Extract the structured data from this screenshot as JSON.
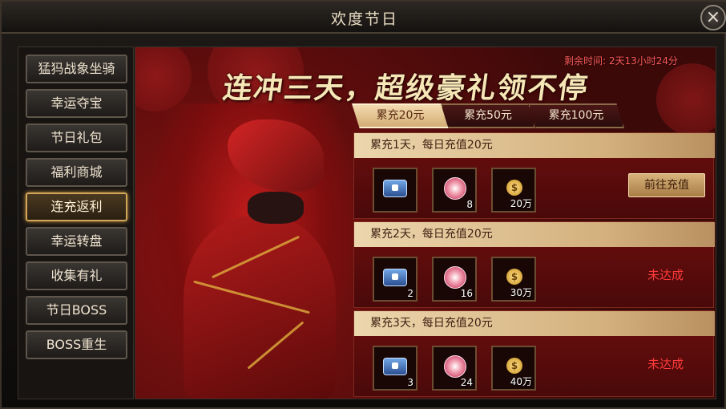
{
  "window": {
    "title": "欢度节日",
    "close_icon": "close-icon"
  },
  "sidebar": {
    "items": [
      {
        "label": "猛犸战象坐骑"
      },
      {
        "label": "幸运夺宝"
      },
      {
        "label": "节日礼包"
      },
      {
        "label": "福利商城"
      },
      {
        "label": "连充返利",
        "active": true
      },
      {
        "label": "幸运转盘"
      },
      {
        "label": "收集有礼"
      },
      {
        "label": "节日BOSS"
      },
      {
        "label": "BOSS重生"
      }
    ]
  },
  "banner": {
    "slogan": "连冲三天，超级豪礼领不停",
    "timer": "剩余时间: 2天13小时24分"
  },
  "tabs": [
    {
      "label": "累充20元",
      "active": true
    },
    {
      "label": "累充50元"
    },
    {
      "label": "累充100元"
    }
  ],
  "rows": [
    {
      "title": "累充1天，每日充值20元",
      "items": [
        {
          "icon": "ticket-icon",
          "qty": ""
        },
        {
          "icon": "flower-icon",
          "qty": "8"
        },
        {
          "icon": "coin-icon",
          "qty": "20万"
        }
      ],
      "action": "前往充值"
    },
    {
      "title": "累充2天，每日充值20元",
      "items": [
        {
          "icon": "ticket-icon",
          "qty": "2"
        },
        {
          "icon": "flower-icon",
          "qty": "16"
        },
        {
          "icon": "coin-icon",
          "qty": "30万"
        }
      ],
      "status": "未达成"
    },
    {
      "title": "累充3天，每日充值20元",
      "items": [
        {
          "icon": "ticket-icon",
          "qty": "3"
        },
        {
          "icon": "flower-icon",
          "qty": "24"
        },
        {
          "icon": "coin-icon",
          "qty": "40万"
        }
      ],
      "status": "未达成"
    }
  ],
  "colors": {
    "accent": "#d3a65a",
    "status_red": "#ff3a3a",
    "banner_red": "#6c0e0e"
  }
}
